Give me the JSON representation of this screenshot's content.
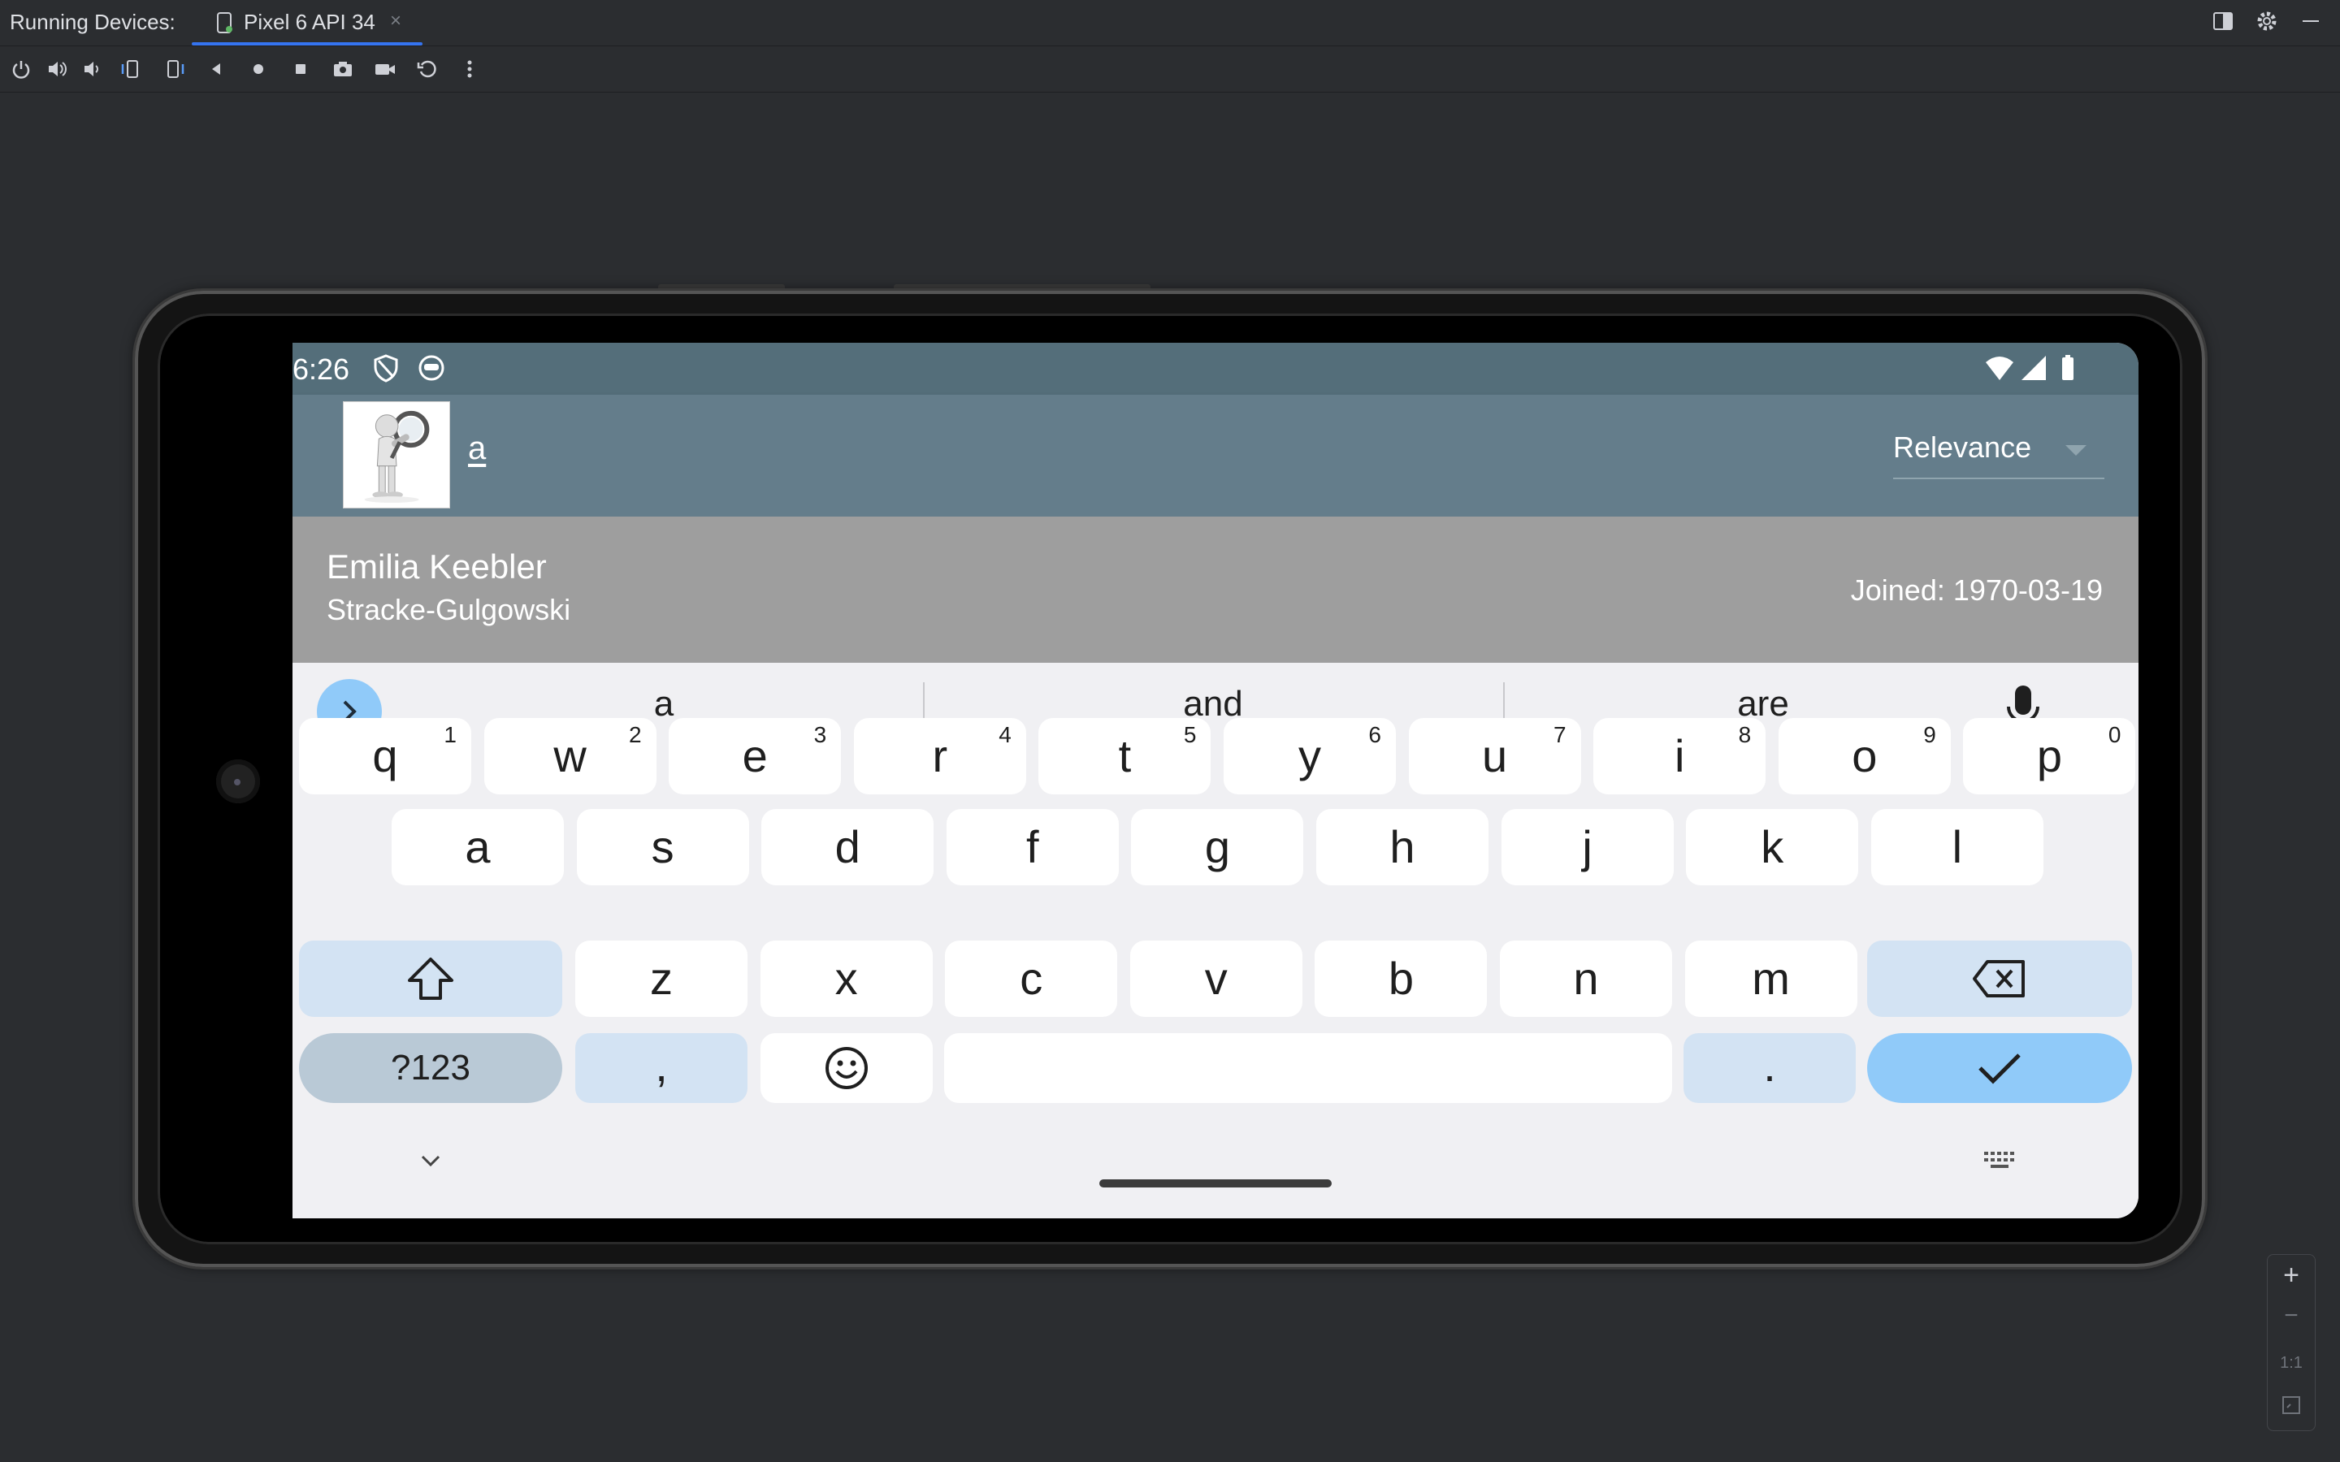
{
  "ide": {
    "running_devices_label": "Running Devices:",
    "device_tab_title": "Pixel 6 API 34",
    "tab_close": "×",
    "toolbar": [
      "power-icon",
      "volume-up-icon",
      "volume-down-icon",
      "rotate-left-icon",
      "rotate-right-icon",
      "back-icon",
      "home-icon",
      "overview-icon",
      "screenshot-icon",
      "screen-record-icon",
      "reset-icon",
      "more-icon"
    ],
    "zoom": {
      "zoom_in": "+",
      "zoom_out": "−",
      "actual_size": "1:1"
    }
  },
  "device": {
    "status": {
      "time": "6:26"
    },
    "app_bar": {
      "search_query": "a",
      "sort": {
        "selected": "Relevance"
      }
    },
    "result": {
      "name": "Emilia Keebler",
      "company": "Stracke-Gulgowski",
      "joined": "Joined: 1970-03-19"
    },
    "keyboard": {
      "suggestions": [
        "a",
        "and",
        "are"
      ],
      "row1": [
        {
          "k": "q",
          "h": "1"
        },
        {
          "k": "w",
          "h": "2"
        },
        {
          "k": "e",
          "h": "3"
        },
        {
          "k": "r",
          "h": "4"
        },
        {
          "k": "t",
          "h": "5"
        },
        {
          "k": "y",
          "h": "6"
        },
        {
          "k": "u",
          "h": "7"
        },
        {
          "k": "i",
          "h": "8"
        },
        {
          "k": "o",
          "h": "9"
        },
        {
          "k": "p",
          "h": "0"
        }
      ],
      "row2": [
        "a",
        "s",
        "d",
        "f",
        "g",
        "h",
        "j",
        "k",
        "l"
      ],
      "row3": [
        "z",
        "x",
        "c",
        "v",
        "b",
        "n",
        "m"
      ],
      "symbols_label": "?123",
      "comma_label": ",",
      "period_label": "."
    }
  },
  "colors": {
    "status_bar": "#546e7a",
    "app_bar": "#647d8b",
    "result_row": "#9e9e9e",
    "accent_key": "#90caf9",
    "mod_key": "#d3e3f3"
  }
}
